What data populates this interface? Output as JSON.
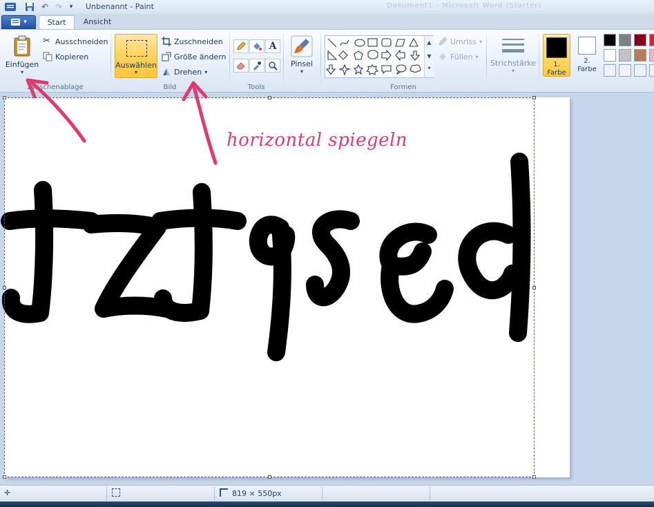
{
  "titlebar": {
    "title": "Unbenannt - Paint",
    "faded_title": "Dokument1 - Microsoft Word (Starter)"
  },
  "tabs": [
    {
      "label": "Start",
      "active": true
    },
    {
      "label": "Ansicht",
      "active": false
    }
  ],
  "groups": {
    "zwischenablage": {
      "label": "Zwischenablage",
      "paste": "Einfügen",
      "cut": "Ausschneiden",
      "copy": "Kopieren"
    },
    "bild": {
      "label": "Bild",
      "select": "Auswählen",
      "crop": "Zuschneiden",
      "resize": "Größe ändern",
      "rotate": "Drehen"
    },
    "tools": {
      "label": "Tools"
    },
    "pinsel": {
      "label": "Pinsel"
    },
    "formen": {
      "label": "Formen",
      "outline": "Umriss",
      "fill": "Füllen"
    },
    "strichstaerke": {
      "label": "Strichstärke"
    },
    "farben": {
      "color1": "1.\nFarbe",
      "color2": "2.\nFarbe",
      "color1_value": "#000000",
      "color2_value": "#ffffff",
      "palette": [
        "#000000",
        "#7f7f7f",
        "#880015",
        "#ed1c24",
        "#ffffff",
        "#c3c3c3",
        "#b97a57",
        "#ffaec9",
        "#eef2f7",
        "#eef2f7",
        "#eef2f7",
        "#eef2f7"
      ]
    }
  },
  "canvas": {
    "mirrored_text": "besetzt",
    "annotation": "horizontal spiegeln",
    "annotation_color": "#e23a6f"
  },
  "status": {
    "canvas_size": "819 × 550px"
  }
}
